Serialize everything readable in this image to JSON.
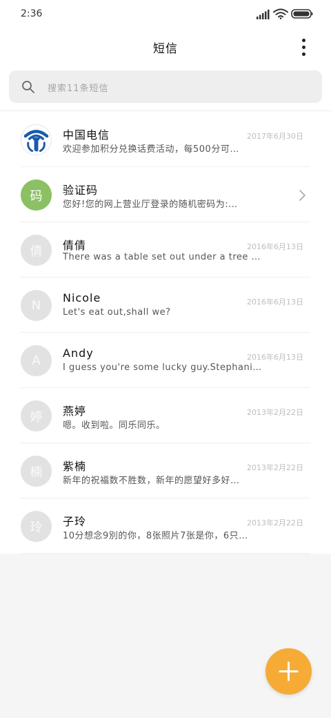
{
  "status_bar": {
    "time": "2:36",
    "icons": [
      "signal-icon",
      "wifi-icon",
      "battery-icon"
    ]
  },
  "header": {
    "title": "短信",
    "more_icon": "more-vert-icon"
  },
  "search": {
    "icon": "search-icon",
    "placeholder": "搜索11条短信"
  },
  "conversations": [
    {
      "name": "中国电信",
      "preview": "欢迎参加积分兑换话费活动，每500分可…",
      "date": "2017年6月30日",
      "avatar_type": "logo",
      "avatar_icon": "china-telecom-logo",
      "avatar_color": "#1a5aab"
    },
    {
      "name": "验证码",
      "preview": "您好!您的网上营业厅登录的随机密码为:…",
      "date": "",
      "avatar_type": "letter",
      "avatar_text": "码",
      "avatar_color": "#8cc065",
      "trailing_icon": "chevron-right-icon"
    },
    {
      "name": "倩倩",
      "preview": "There was a table set out under a tree …",
      "date": "2016年6月13日",
      "avatar_type": "letter",
      "avatar_text": "倩",
      "avatar_color": "#e2e2e2"
    },
    {
      "name": "Nicole",
      "preview": "Let's eat out,shall we?",
      "date": "2016年6月13日",
      "avatar_type": "letter",
      "avatar_text": "N",
      "avatar_color": "#e2e2e2"
    },
    {
      "name": "Andy",
      "preview": "I guess you're some lucky guy.Stephani…",
      "date": "2016年6月13日",
      "avatar_type": "letter",
      "avatar_text": "A",
      "avatar_color": "#e2e2e2"
    },
    {
      "name": "燕婷",
      "preview": "嗯。收到啦。同乐同乐。",
      "date": "2013年2月22日",
      "avatar_type": "letter",
      "avatar_text": "婷",
      "avatar_color": "#e2e2e2"
    },
    {
      "name": "紫楠",
      "preview": "新年的祝福数不胜数，新年的愿望好多好…",
      "date": "2013年2月22日",
      "avatar_type": "letter",
      "avatar_text": "楠",
      "avatar_color": "#e2e2e2"
    },
    {
      "name": "子玲",
      "preview": "10分想念9別的你，8张照片7张是你，6只…",
      "date": "2013年2月22日",
      "avatar_type": "letter",
      "avatar_text": "玲",
      "avatar_color": "#e2e2e2"
    }
  ],
  "fab": {
    "icon": "plus-icon",
    "color": "#f5ab35"
  }
}
